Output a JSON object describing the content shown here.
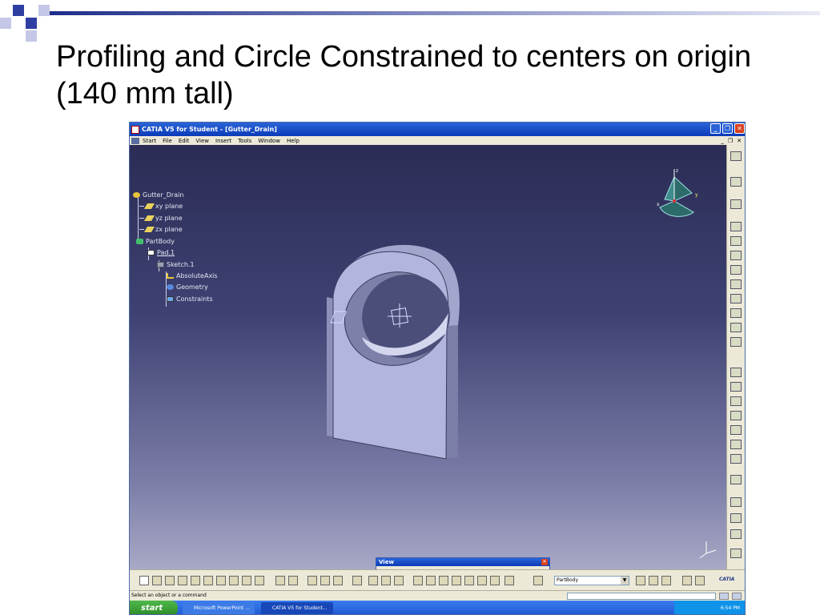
{
  "slide": {
    "title": "Profiling and Circle Constrained to centers on origin (140 mm tall)"
  },
  "window": {
    "title": "CATIA V5 for Student - [Gutter_Drain]",
    "controls": {
      "minimize": "_",
      "restore": "❐",
      "close": "✕"
    },
    "doc_controls": {
      "minimize": "_",
      "restore": "❐",
      "close": "✕"
    }
  },
  "menu": {
    "items": [
      "Start",
      "File",
      "Edit",
      "View",
      "Insert",
      "Tools",
      "Window",
      "Help"
    ]
  },
  "tree": {
    "root": "Gutter_Drain",
    "planes": [
      "xy plane",
      "yz plane",
      "zx plane"
    ],
    "body": "PartBody",
    "pad": "Pad.1",
    "sketch": "Sketch.1",
    "sketch_children": [
      "AbsoluteAxis",
      "Geometry",
      "Constraints"
    ]
  },
  "compass": {
    "x": "x",
    "y": "y",
    "z": "z"
  },
  "view_toolbar": {
    "title": "View",
    "close": "✕"
  },
  "bottom_toolbar": {
    "workbench_combo": "PartBody",
    "combo_arrow": "▼",
    "catia_logo": "CATIA"
  },
  "status": {
    "prompt": "Select an object or a command"
  },
  "taskbar": {
    "start": "start",
    "tasks": [
      "Microsoft PowerPoint ...",
      "CATIA V5 for Student..."
    ],
    "clock": "6:54 PM"
  },
  "colors": {
    "viewport_top": "#2b2c55",
    "viewport_bottom": "#a8a9c6",
    "part": "#b2b5dd",
    "titlebar": "#0a3bb7",
    "slide_bar": "#1f2e8a"
  }
}
